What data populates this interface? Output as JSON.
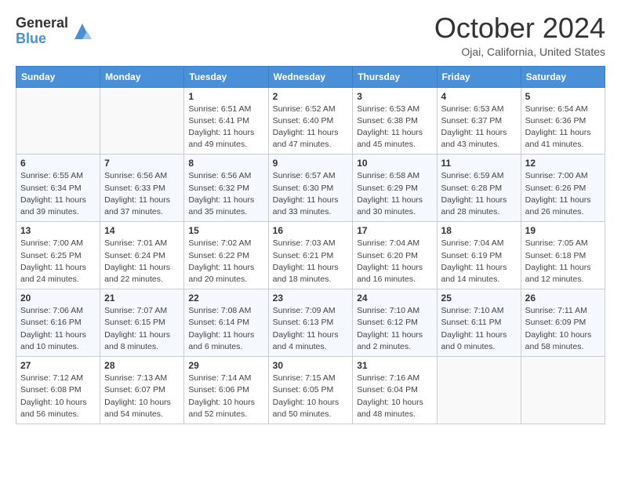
{
  "logo": {
    "general": "General",
    "blue": "Blue"
  },
  "title": "October 2024",
  "location": "Ojai, California, United States",
  "days_header": [
    "Sunday",
    "Monday",
    "Tuesday",
    "Wednesday",
    "Thursday",
    "Friday",
    "Saturday"
  ],
  "weeks": [
    [
      {
        "day": "",
        "sunrise": "",
        "sunset": "",
        "daylight": ""
      },
      {
        "day": "",
        "sunrise": "",
        "sunset": "",
        "daylight": ""
      },
      {
        "day": "1",
        "sunrise": "Sunrise: 6:51 AM",
        "sunset": "Sunset: 6:41 PM",
        "daylight": "Daylight: 11 hours and 49 minutes."
      },
      {
        "day": "2",
        "sunrise": "Sunrise: 6:52 AM",
        "sunset": "Sunset: 6:40 PM",
        "daylight": "Daylight: 11 hours and 47 minutes."
      },
      {
        "day": "3",
        "sunrise": "Sunrise: 6:53 AM",
        "sunset": "Sunset: 6:38 PM",
        "daylight": "Daylight: 11 hours and 45 minutes."
      },
      {
        "day": "4",
        "sunrise": "Sunrise: 6:53 AM",
        "sunset": "Sunset: 6:37 PM",
        "daylight": "Daylight: 11 hours and 43 minutes."
      },
      {
        "day": "5",
        "sunrise": "Sunrise: 6:54 AM",
        "sunset": "Sunset: 6:36 PM",
        "daylight": "Daylight: 11 hours and 41 minutes."
      }
    ],
    [
      {
        "day": "6",
        "sunrise": "Sunrise: 6:55 AM",
        "sunset": "Sunset: 6:34 PM",
        "daylight": "Daylight: 11 hours and 39 minutes."
      },
      {
        "day": "7",
        "sunrise": "Sunrise: 6:56 AM",
        "sunset": "Sunset: 6:33 PM",
        "daylight": "Daylight: 11 hours and 37 minutes."
      },
      {
        "day": "8",
        "sunrise": "Sunrise: 6:56 AM",
        "sunset": "Sunset: 6:32 PM",
        "daylight": "Daylight: 11 hours and 35 minutes."
      },
      {
        "day": "9",
        "sunrise": "Sunrise: 6:57 AM",
        "sunset": "Sunset: 6:30 PM",
        "daylight": "Daylight: 11 hours and 33 minutes."
      },
      {
        "day": "10",
        "sunrise": "Sunrise: 6:58 AM",
        "sunset": "Sunset: 6:29 PM",
        "daylight": "Daylight: 11 hours and 30 minutes."
      },
      {
        "day": "11",
        "sunrise": "Sunrise: 6:59 AM",
        "sunset": "Sunset: 6:28 PM",
        "daylight": "Daylight: 11 hours and 28 minutes."
      },
      {
        "day": "12",
        "sunrise": "Sunrise: 7:00 AM",
        "sunset": "Sunset: 6:26 PM",
        "daylight": "Daylight: 11 hours and 26 minutes."
      }
    ],
    [
      {
        "day": "13",
        "sunrise": "Sunrise: 7:00 AM",
        "sunset": "Sunset: 6:25 PM",
        "daylight": "Daylight: 11 hours and 24 minutes."
      },
      {
        "day": "14",
        "sunrise": "Sunrise: 7:01 AM",
        "sunset": "Sunset: 6:24 PM",
        "daylight": "Daylight: 11 hours and 22 minutes."
      },
      {
        "day": "15",
        "sunrise": "Sunrise: 7:02 AM",
        "sunset": "Sunset: 6:22 PM",
        "daylight": "Daylight: 11 hours and 20 minutes."
      },
      {
        "day": "16",
        "sunrise": "Sunrise: 7:03 AM",
        "sunset": "Sunset: 6:21 PM",
        "daylight": "Daylight: 11 hours and 18 minutes."
      },
      {
        "day": "17",
        "sunrise": "Sunrise: 7:04 AM",
        "sunset": "Sunset: 6:20 PM",
        "daylight": "Daylight: 11 hours and 16 minutes."
      },
      {
        "day": "18",
        "sunrise": "Sunrise: 7:04 AM",
        "sunset": "Sunset: 6:19 PM",
        "daylight": "Daylight: 11 hours and 14 minutes."
      },
      {
        "day": "19",
        "sunrise": "Sunrise: 7:05 AM",
        "sunset": "Sunset: 6:18 PM",
        "daylight": "Daylight: 11 hours and 12 minutes."
      }
    ],
    [
      {
        "day": "20",
        "sunrise": "Sunrise: 7:06 AM",
        "sunset": "Sunset: 6:16 PM",
        "daylight": "Daylight: 11 hours and 10 minutes."
      },
      {
        "day": "21",
        "sunrise": "Sunrise: 7:07 AM",
        "sunset": "Sunset: 6:15 PM",
        "daylight": "Daylight: 11 hours and 8 minutes."
      },
      {
        "day": "22",
        "sunrise": "Sunrise: 7:08 AM",
        "sunset": "Sunset: 6:14 PM",
        "daylight": "Daylight: 11 hours and 6 minutes."
      },
      {
        "day": "23",
        "sunrise": "Sunrise: 7:09 AM",
        "sunset": "Sunset: 6:13 PM",
        "daylight": "Daylight: 11 hours and 4 minutes."
      },
      {
        "day": "24",
        "sunrise": "Sunrise: 7:10 AM",
        "sunset": "Sunset: 6:12 PM",
        "daylight": "Daylight: 11 hours and 2 minutes."
      },
      {
        "day": "25",
        "sunrise": "Sunrise: 7:10 AM",
        "sunset": "Sunset: 6:11 PM",
        "daylight": "Daylight: 11 hours and 0 minutes."
      },
      {
        "day": "26",
        "sunrise": "Sunrise: 7:11 AM",
        "sunset": "Sunset: 6:09 PM",
        "daylight": "Daylight: 10 hours and 58 minutes."
      }
    ],
    [
      {
        "day": "27",
        "sunrise": "Sunrise: 7:12 AM",
        "sunset": "Sunset: 6:08 PM",
        "daylight": "Daylight: 10 hours and 56 minutes."
      },
      {
        "day": "28",
        "sunrise": "Sunrise: 7:13 AM",
        "sunset": "Sunset: 6:07 PM",
        "daylight": "Daylight: 10 hours and 54 minutes."
      },
      {
        "day": "29",
        "sunrise": "Sunrise: 7:14 AM",
        "sunset": "Sunset: 6:06 PM",
        "daylight": "Daylight: 10 hours and 52 minutes."
      },
      {
        "day": "30",
        "sunrise": "Sunrise: 7:15 AM",
        "sunset": "Sunset: 6:05 PM",
        "daylight": "Daylight: 10 hours and 50 minutes."
      },
      {
        "day": "31",
        "sunrise": "Sunrise: 7:16 AM",
        "sunset": "Sunset: 6:04 PM",
        "daylight": "Daylight: 10 hours and 48 minutes."
      },
      {
        "day": "",
        "sunrise": "",
        "sunset": "",
        "daylight": ""
      },
      {
        "day": "",
        "sunrise": "",
        "sunset": "",
        "daylight": ""
      }
    ]
  ]
}
